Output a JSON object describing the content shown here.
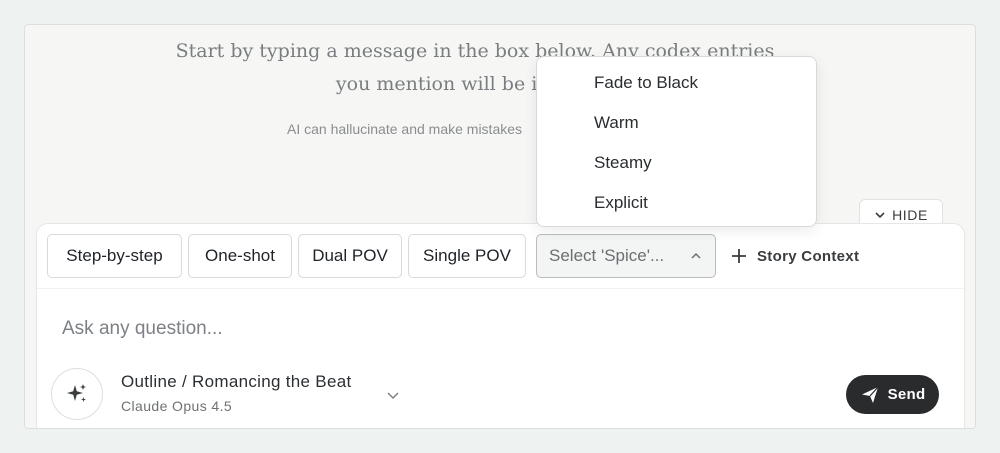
{
  "intro": {
    "line1": "Start by typing a message in the box below. Any codex entries",
    "line2": "you mention will be included"
  },
  "disclaimer": "AI can hallucinate and make mistakes",
  "hide_label": "HIDE",
  "toolbar": {
    "chips": [
      "Step-by-step",
      "One-shot",
      "Dual POV",
      "Single POV"
    ],
    "spice_placeholder": "Select 'Spice'...",
    "story_context": "Story Context"
  },
  "spice_dropdown": {
    "options": [
      "Fade to Black",
      "Warm",
      "Steamy",
      "Explicit"
    ]
  },
  "input": {
    "placeholder": "Ask any question..."
  },
  "model": {
    "title": "Outline / Romancing the Beat",
    "subtitle": "Claude Opus 4.5",
    "icon": "sparkles-icon"
  },
  "send_label": "Send",
  "colors": {
    "background": "#eef3f2",
    "panel": "#f6f6f5",
    "send_button": "#2a2b2d"
  }
}
